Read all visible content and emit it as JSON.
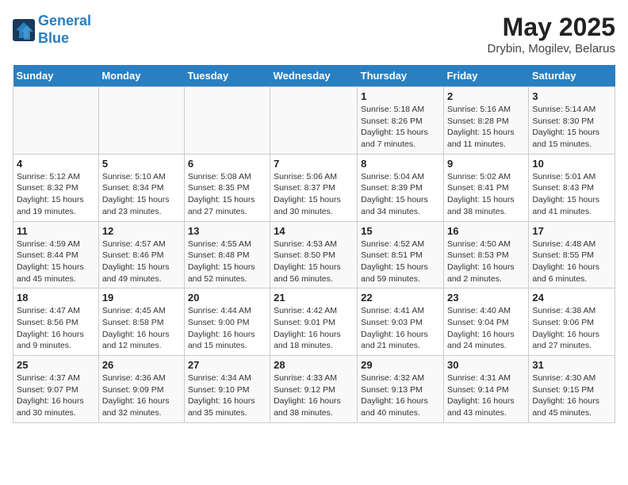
{
  "header": {
    "logo_line1": "General",
    "logo_line2": "Blue",
    "month": "May 2025",
    "location": "Drybin, Mogilev, Belarus"
  },
  "weekdays": [
    "Sunday",
    "Monday",
    "Tuesday",
    "Wednesday",
    "Thursday",
    "Friday",
    "Saturday"
  ],
  "weeks": [
    [
      {
        "day": "",
        "info": ""
      },
      {
        "day": "",
        "info": ""
      },
      {
        "day": "",
        "info": ""
      },
      {
        "day": "",
        "info": ""
      },
      {
        "day": "1",
        "info": "Sunrise: 5:18 AM\nSunset: 8:26 PM\nDaylight: 15 hours\nand 7 minutes."
      },
      {
        "day": "2",
        "info": "Sunrise: 5:16 AM\nSunset: 8:28 PM\nDaylight: 15 hours\nand 11 minutes."
      },
      {
        "day": "3",
        "info": "Sunrise: 5:14 AM\nSunset: 8:30 PM\nDaylight: 15 hours\nand 15 minutes."
      }
    ],
    [
      {
        "day": "4",
        "info": "Sunrise: 5:12 AM\nSunset: 8:32 PM\nDaylight: 15 hours\nand 19 minutes."
      },
      {
        "day": "5",
        "info": "Sunrise: 5:10 AM\nSunset: 8:34 PM\nDaylight: 15 hours\nand 23 minutes."
      },
      {
        "day": "6",
        "info": "Sunrise: 5:08 AM\nSunset: 8:35 PM\nDaylight: 15 hours\nand 27 minutes."
      },
      {
        "day": "7",
        "info": "Sunrise: 5:06 AM\nSunset: 8:37 PM\nDaylight: 15 hours\nand 30 minutes."
      },
      {
        "day": "8",
        "info": "Sunrise: 5:04 AM\nSunset: 8:39 PM\nDaylight: 15 hours\nand 34 minutes."
      },
      {
        "day": "9",
        "info": "Sunrise: 5:02 AM\nSunset: 8:41 PM\nDaylight: 15 hours\nand 38 minutes."
      },
      {
        "day": "10",
        "info": "Sunrise: 5:01 AM\nSunset: 8:43 PM\nDaylight: 15 hours\nand 41 minutes."
      }
    ],
    [
      {
        "day": "11",
        "info": "Sunrise: 4:59 AM\nSunset: 8:44 PM\nDaylight: 15 hours\nand 45 minutes."
      },
      {
        "day": "12",
        "info": "Sunrise: 4:57 AM\nSunset: 8:46 PM\nDaylight: 15 hours\nand 49 minutes."
      },
      {
        "day": "13",
        "info": "Sunrise: 4:55 AM\nSunset: 8:48 PM\nDaylight: 15 hours\nand 52 minutes."
      },
      {
        "day": "14",
        "info": "Sunrise: 4:53 AM\nSunset: 8:50 PM\nDaylight: 15 hours\nand 56 minutes."
      },
      {
        "day": "15",
        "info": "Sunrise: 4:52 AM\nSunset: 8:51 PM\nDaylight: 15 hours\nand 59 minutes."
      },
      {
        "day": "16",
        "info": "Sunrise: 4:50 AM\nSunset: 8:53 PM\nDaylight: 16 hours\nand 2 minutes."
      },
      {
        "day": "17",
        "info": "Sunrise: 4:48 AM\nSunset: 8:55 PM\nDaylight: 16 hours\nand 6 minutes."
      }
    ],
    [
      {
        "day": "18",
        "info": "Sunrise: 4:47 AM\nSunset: 8:56 PM\nDaylight: 16 hours\nand 9 minutes."
      },
      {
        "day": "19",
        "info": "Sunrise: 4:45 AM\nSunset: 8:58 PM\nDaylight: 16 hours\nand 12 minutes."
      },
      {
        "day": "20",
        "info": "Sunrise: 4:44 AM\nSunset: 9:00 PM\nDaylight: 16 hours\nand 15 minutes."
      },
      {
        "day": "21",
        "info": "Sunrise: 4:42 AM\nSunset: 9:01 PM\nDaylight: 16 hours\nand 18 minutes."
      },
      {
        "day": "22",
        "info": "Sunrise: 4:41 AM\nSunset: 9:03 PM\nDaylight: 16 hours\nand 21 minutes."
      },
      {
        "day": "23",
        "info": "Sunrise: 4:40 AM\nSunset: 9:04 PM\nDaylight: 16 hours\nand 24 minutes."
      },
      {
        "day": "24",
        "info": "Sunrise: 4:38 AM\nSunset: 9:06 PM\nDaylight: 16 hours\nand 27 minutes."
      }
    ],
    [
      {
        "day": "25",
        "info": "Sunrise: 4:37 AM\nSunset: 9:07 PM\nDaylight: 16 hours\nand 30 minutes."
      },
      {
        "day": "26",
        "info": "Sunrise: 4:36 AM\nSunset: 9:09 PM\nDaylight: 16 hours\nand 32 minutes."
      },
      {
        "day": "27",
        "info": "Sunrise: 4:34 AM\nSunset: 9:10 PM\nDaylight: 16 hours\nand 35 minutes."
      },
      {
        "day": "28",
        "info": "Sunrise: 4:33 AM\nSunset: 9:12 PM\nDaylight: 16 hours\nand 38 minutes."
      },
      {
        "day": "29",
        "info": "Sunrise: 4:32 AM\nSunset: 9:13 PM\nDaylight: 16 hours\nand 40 minutes."
      },
      {
        "day": "30",
        "info": "Sunrise: 4:31 AM\nSunset: 9:14 PM\nDaylight: 16 hours\nand 43 minutes."
      },
      {
        "day": "31",
        "info": "Sunrise: 4:30 AM\nSunset: 9:15 PM\nDaylight: 16 hours\nand 45 minutes."
      }
    ]
  ]
}
